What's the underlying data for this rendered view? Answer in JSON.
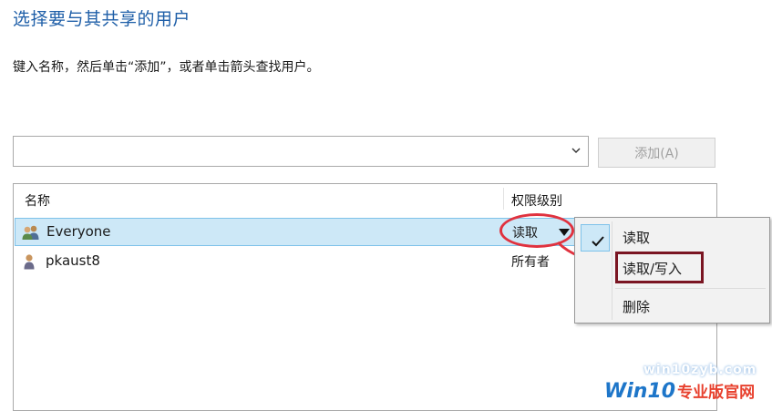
{
  "dialog": {
    "title": "选择要与其共享的用户",
    "instructions": "键入名称，然后单击“添加”，或者单击箭头查找用户。"
  },
  "input": {
    "value": "",
    "arrow_icon": "chevron-down-icon"
  },
  "add_button": {
    "label": "添加(A)"
  },
  "list": {
    "columns": {
      "name": "名称",
      "permission": "权限级别"
    },
    "rows": [
      {
        "name": "Everyone",
        "permission": "读取",
        "icon": "group-users-icon",
        "selected": true
      },
      {
        "name": "pkaust8",
        "permission": "所有者",
        "icon": "user-icon",
        "selected": false
      }
    ]
  },
  "context_menu": {
    "items": [
      {
        "label": "读取",
        "checked": true
      },
      {
        "label": "读取/写入",
        "checked": false
      },
      {
        "label": "删除",
        "checked": false
      }
    ]
  },
  "annotations": {
    "highlight_color": "#e0323f",
    "box_color": "#7a1522"
  },
  "watermark": {
    "url": "win10zyb.com",
    "brand": "Win10",
    "brand_cn": "专业版官网"
  },
  "colors": {
    "title": "#1f5fa8",
    "selection": "#cde8f7",
    "selection_border": "#7ec2ea"
  }
}
